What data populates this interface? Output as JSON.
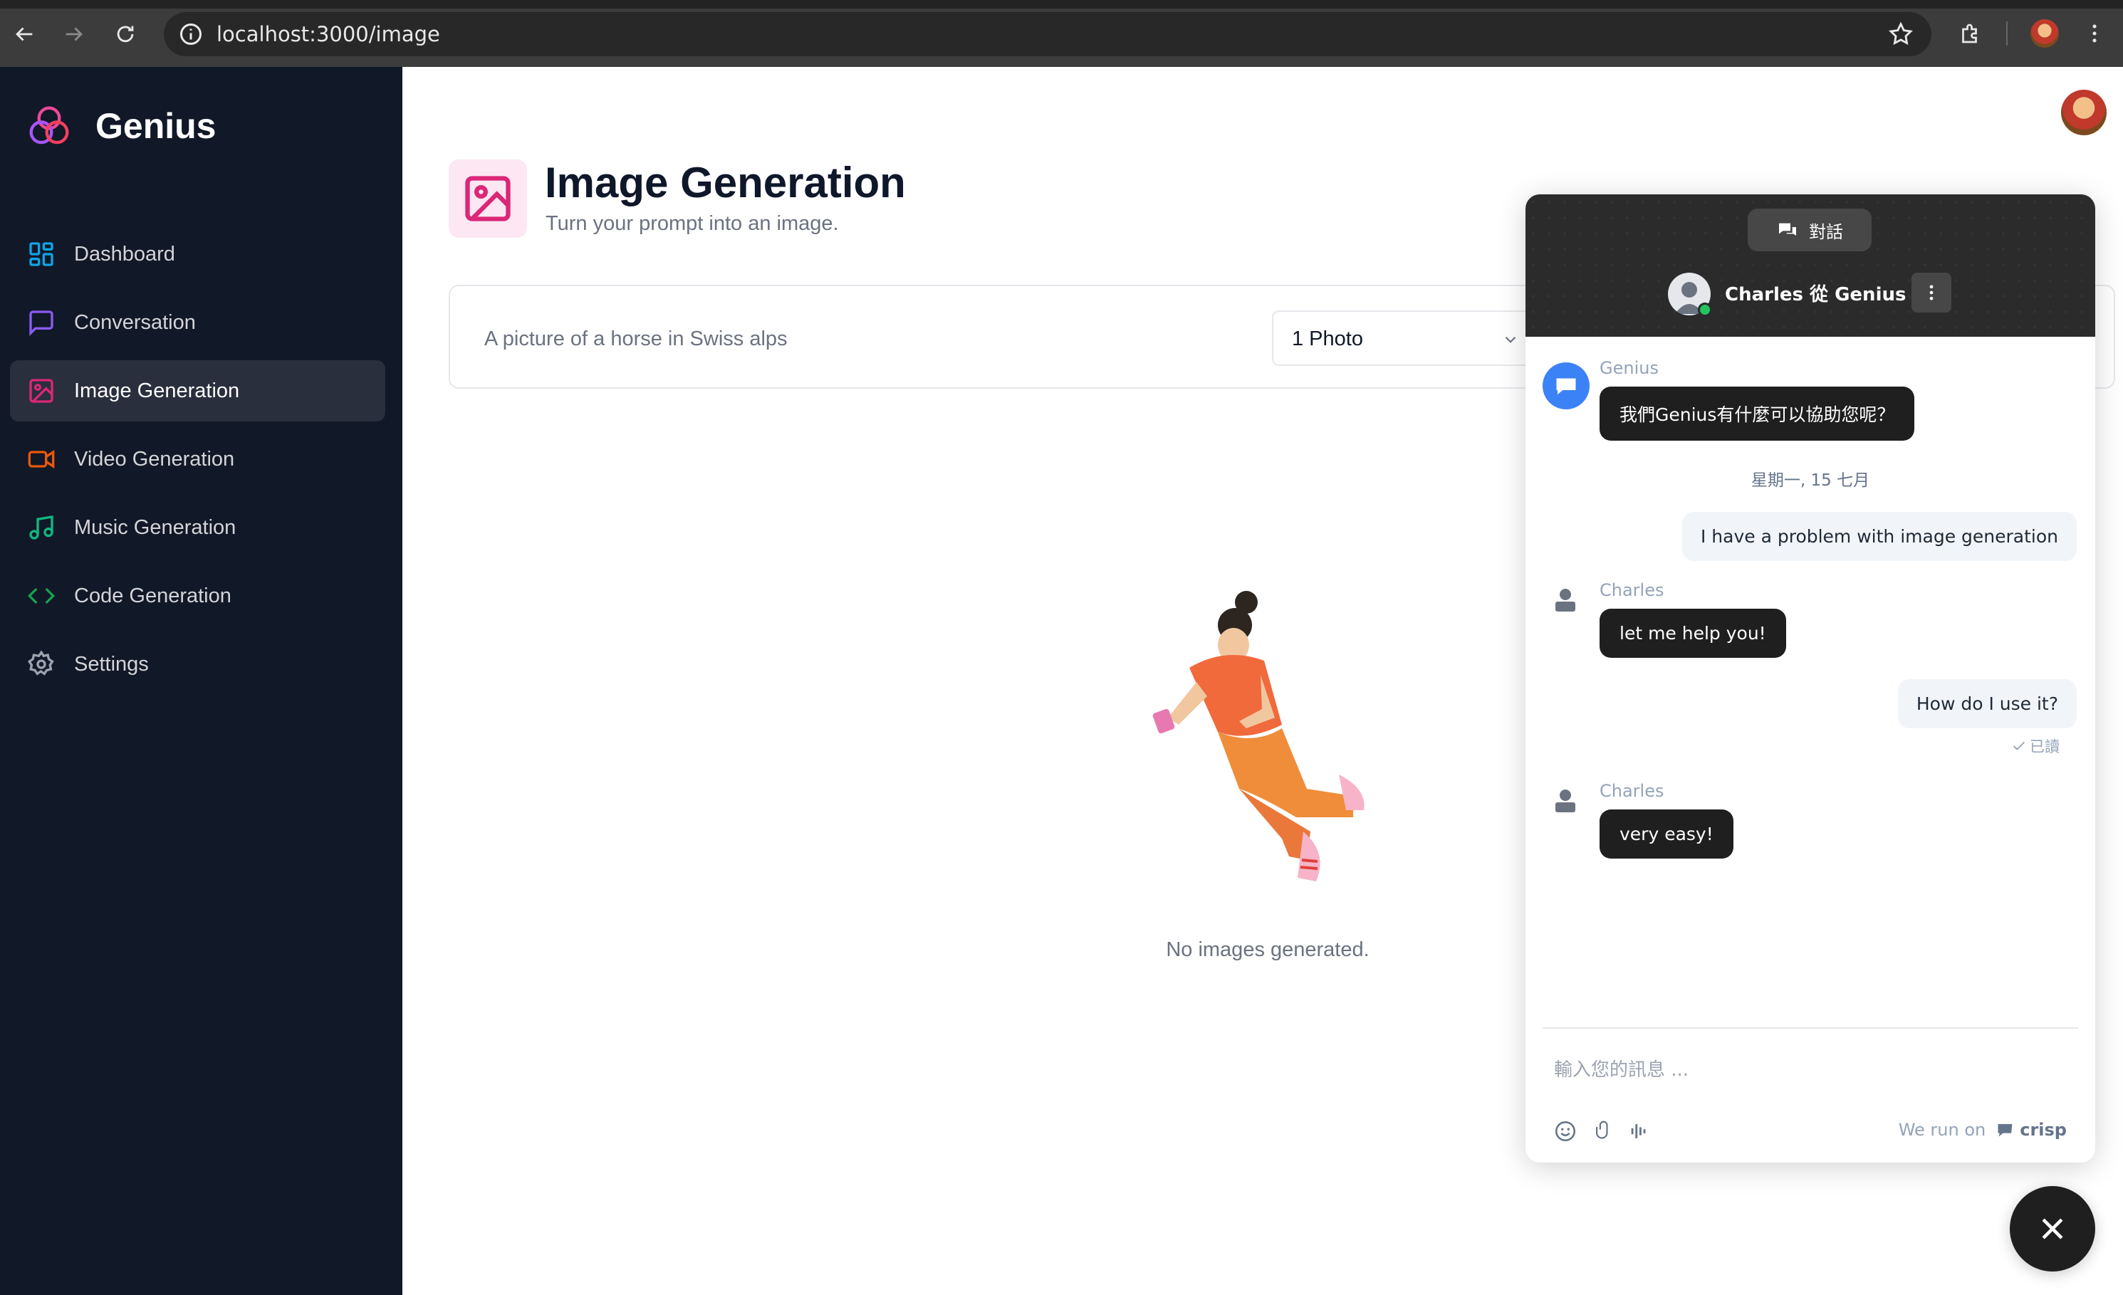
{
  "browser": {
    "url": "localhost:3000/image"
  },
  "sidebar": {
    "brand": "Genius",
    "items": [
      {
        "label": "Dashboard",
        "icon": "layout-dashboard-icon",
        "color": "#0ea5e9"
      },
      {
        "label": "Conversation",
        "icon": "message-square-icon",
        "color": "#8b5cf6"
      },
      {
        "label": "Image Generation",
        "icon": "image-icon",
        "color": "#db2777",
        "active": true
      },
      {
        "label": "Video Generation",
        "icon": "video-icon",
        "color": "#ea580c"
      },
      {
        "label": "Music Generation",
        "icon": "music-icon",
        "color": "#10b981"
      },
      {
        "label": "Code Generation",
        "icon": "code-icon",
        "color": "#16a34a"
      },
      {
        "label": "Settings",
        "icon": "settings-icon",
        "color": "#9ca3af"
      }
    ]
  },
  "page": {
    "title": "Image Generation",
    "subtitle": "Turn your prompt into an image.",
    "accent": "#db2777",
    "accent_bg": "#fce7f3"
  },
  "prompt": {
    "value": "A picture of a horse in Swiss alps",
    "amount": "1 Photo"
  },
  "empty_state": {
    "text": "No images generated."
  },
  "chat": {
    "tab_label": "對話",
    "agent_header": "Charles 從 Genius",
    "date_separator": "星期一, 15 七月",
    "read_receipt": "已讀",
    "messages": [
      {
        "from": "Genius",
        "text": "我們Genius有什麼可以協助您呢？",
        "side": "left"
      },
      {
        "from": "",
        "text": "I have a problem with image generation",
        "side": "right"
      },
      {
        "from": "Charles",
        "text": "let me help you!",
        "side": "left"
      },
      {
        "from": "",
        "text": "How do I use it?",
        "side": "right"
      },
      {
        "from": "Charles",
        "text": "very easy!",
        "side": "left"
      }
    ],
    "compose_placeholder": "輸入您的訊息 ...",
    "powered_by": "We run on",
    "powered_brand": "crisp"
  }
}
